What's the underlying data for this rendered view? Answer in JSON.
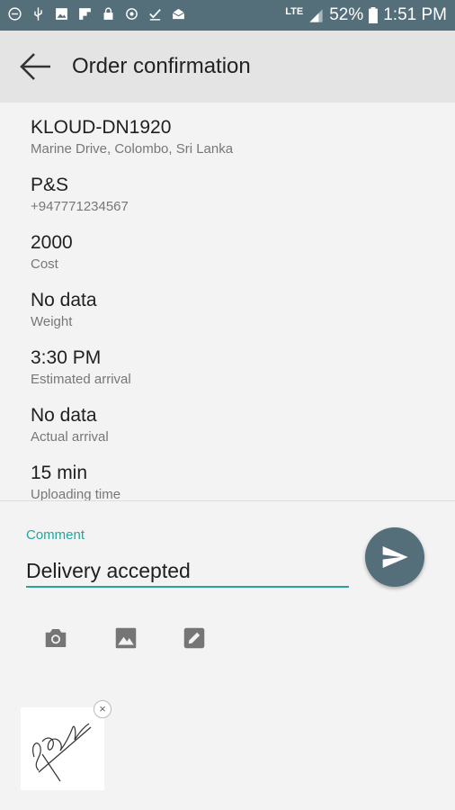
{
  "status_bar": {
    "network": "LTE",
    "battery": "52%",
    "time": "1:51 PM",
    "left_icons": [
      "do-not-disturb-icon",
      "usb-icon",
      "image-icon",
      "flipboard-icon",
      "lock-icon",
      "sync-icon",
      "task-done-icon",
      "mail-icon"
    ]
  },
  "app_bar": {
    "title": "Order confirmation"
  },
  "details": [
    {
      "value": "KLOUD-DN1920",
      "label": "Marine Drive, Colombo, Sri Lanka"
    },
    {
      "value": "P&S",
      "label": "+947771234567"
    },
    {
      "value": "2000",
      "label": "Cost"
    },
    {
      "value": "No data",
      "label": "Weight"
    },
    {
      "value": "3:30 PM",
      "label": "Estimated arrival"
    },
    {
      "value": "No data",
      "label": "Actual arrival"
    },
    {
      "value": "15 min",
      "label": "Uploading time"
    }
  ],
  "comment": {
    "label": "Comment",
    "value": "Delivery accepted"
  },
  "tools": [
    "camera-icon",
    "gallery-icon",
    "edit-icon"
  ],
  "colors": {
    "status_bar": "#546e7a",
    "accent": "#26a69a",
    "fab": "#546e7a"
  }
}
